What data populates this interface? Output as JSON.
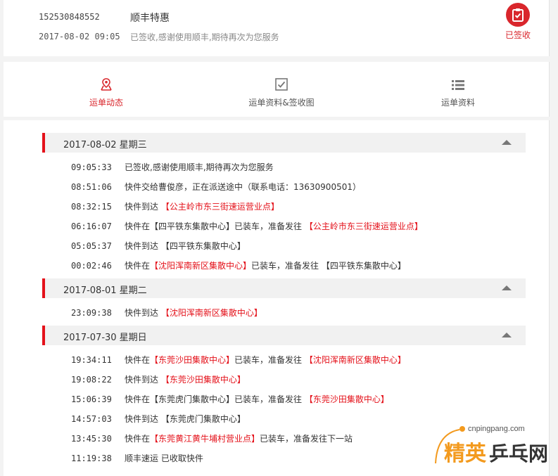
{
  "header": {
    "tracking_number": "152530848552",
    "product": "顺丰特惠",
    "datetime": "2017-08-02 09:05",
    "message": "已签收,感谢使用顺丰,期待再次为您服务",
    "status_label": "已签收"
  },
  "tabs": [
    {
      "label": "运单动态",
      "active": true
    },
    {
      "label": "运单资料&签收图",
      "active": false
    },
    {
      "label": "运单资料",
      "active": false
    }
  ],
  "days": [
    {
      "date": "2017-08-02 星期三",
      "events": [
        {
          "time": "09:05:33",
          "parts": [
            {
              "text": "已签收,感谢使用顺丰,期待再次为您服务",
              "red": false
            }
          ]
        },
        {
          "time": "08:51:06",
          "parts": [
            {
              "text": "快件交给曹俊彦，正在派送途中（联系电话：13630900501）",
              "red": false
            }
          ]
        },
        {
          "time": "08:32:15",
          "parts": [
            {
              "text": "快件到达 ",
              "red": false
            },
            {
              "text": "【公主岭市东三街速运营业点】",
              "red": true
            }
          ]
        },
        {
          "time": "06:16:07",
          "parts": [
            {
              "text": "快件在【四平铁东集散中心】已装车，准备发往 ",
              "red": false
            },
            {
              "text": "【公主岭市东三街速运营业点】",
              "red": true
            }
          ]
        },
        {
          "time": "05:05:37",
          "parts": [
            {
              "text": "快件到达 【四平铁东集散中心】",
              "red": false
            }
          ]
        },
        {
          "time": "00:02:46",
          "parts": [
            {
              "text": "快件在",
              "red": false
            },
            {
              "text": "【沈阳浑南新区集散中心】",
              "red": true
            },
            {
              "text": "已装车，准备发往 【四平铁东集散中心】",
              "red": false
            }
          ]
        }
      ]
    },
    {
      "date": "2017-08-01 星期二",
      "events": [
        {
          "time": "23:09:38",
          "parts": [
            {
              "text": "快件到达 ",
              "red": false
            },
            {
              "text": "【沈阳浑南新区集散中心】",
              "red": true
            }
          ]
        }
      ]
    },
    {
      "date": "2017-07-30 星期日",
      "events": [
        {
          "time": "19:34:11",
          "parts": [
            {
              "text": "快件在",
              "red": false
            },
            {
              "text": "【东莞沙田集散中心】",
              "red": true
            },
            {
              "text": "已装车，准备发往 ",
              "red": false
            },
            {
              "text": "【沈阳浑南新区集散中心】",
              "red": true
            }
          ]
        },
        {
          "time": "19:08:22",
          "parts": [
            {
              "text": "快件到达 ",
              "red": false
            },
            {
              "text": "【东莞沙田集散中心】",
              "red": true
            }
          ]
        },
        {
          "time": "15:06:39",
          "parts": [
            {
              "text": "快件在【东莞虎门集散中心】已装车，准备发往 ",
              "red": false
            },
            {
              "text": "【东莞沙田集散中心】",
              "red": true
            }
          ]
        },
        {
          "time": "14:57:03",
          "parts": [
            {
              "text": "快件到达 【东莞虎门集散中心】",
              "red": false
            }
          ]
        },
        {
          "time": "13:45:30",
          "parts": [
            {
              "text": "快件在",
              "red": false
            },
            {
              "text": "【东莞黄江黄牛埔村营业点】",
              "red": true
            },
            {
              "text": "已装车，准备发往下一站",
              "red": false
            }
          ]
        },
        {
          "time": "11:19:38",
          "parts": [
            {
              "text": "顺丰速运 已收取快件",
              "red": false
            }
          ]
        }
      ]
    }
  ],
  "watermark": {
    "site": "cnpingpang.com",
    "brand_a": "精英",
    "brand_b": "乒乓网"
  },
  "colors": {
    "accent": "#d9262c",
    "day_bar": "#e4111a",
    "watermark_orange": "#f39a1e"
  }
}
